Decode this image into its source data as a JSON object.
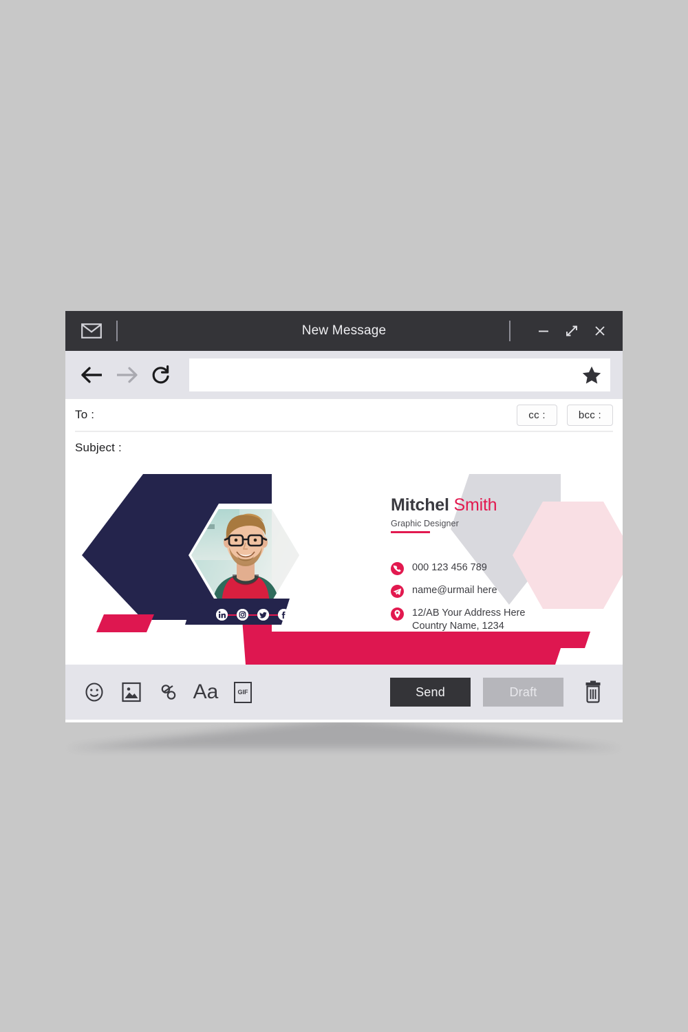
{
  "window": {
    "titlebar": {
      "mail_icon": "mail-icon",
      "title": "New Message",
      "minimize_icon": "minimize-icon",
      "maximize_icon": "maximize-icon",
      "close_icon": "close-icon"
    },
    "navbar": {
      "back_icon": "arrow-left-icon",
      "forward_icon": "arrow-right-icon",
      "reload_icon": "reload-icon",
      "address_value": "",
      "address_placeholder": "",
      "star_icon": "star-icon"
    },
    "fields": {
      "to_label": "To :",
      "to_value": "",
      "cc_label": "cc :",
      "bcc_label": "bcc :",
      "subject_label": "Subject :",
      "subject_value": ""
    },
    "toolbar": {
      "emoji_icon": "emoji-icon",
      "image_icon": "image-icon",
      "link_icon": "link-icon",
      "font_icon": "font-icon",
      "font_glyph": "Aa",
      "gif_icon": "gif-icon",
      "gif_glyph": "GIF",
      "send_label": "Send",
      "draft_label": "Draft",
      "trash_icon": "trash-icon"
    }
  },
  "signature": {
    "first_name": "Mitchel",
    "last_name": "Smith",
    "role": "Graphic Designer",
    "contacts": [
      {
        "icon": "phone-icon",
        "text": "000 123 456 789"
      },
      {
        "icon": "telegram-icon",
        "text": "name@urmail here"
      },
      {
        "icon": "location-icon",
        "text": "12/AB Your Address Here\nCountry Name, 1234"
      }
    ],
    "social": [
      {
        "icon": "linkedin-icon",
        "glyph": "in"
      },
      {
        "icon": "instagram-icon",
        "glyph": ""
      },
      {
        "icon": "twitter-icon",
        "glyph": ""
      },
      {
        "icon": "facebook-icon",
        "glyph": "f"
      }
    ],
    "photo_alt": "portrait-photo"
  },
  "colors": {
    "navy": "#24244c",
    "crimson": "#de1750",
    "pink_light": "#f9dfe4",
    "gray_shape": "#d9d9de",
    "titlebar": "#343438",
    "navbar": "#e3e3e9",
    "toolbar": "#e4e4ea",
    "page_bg": "#c8c8c8"
  }
}
